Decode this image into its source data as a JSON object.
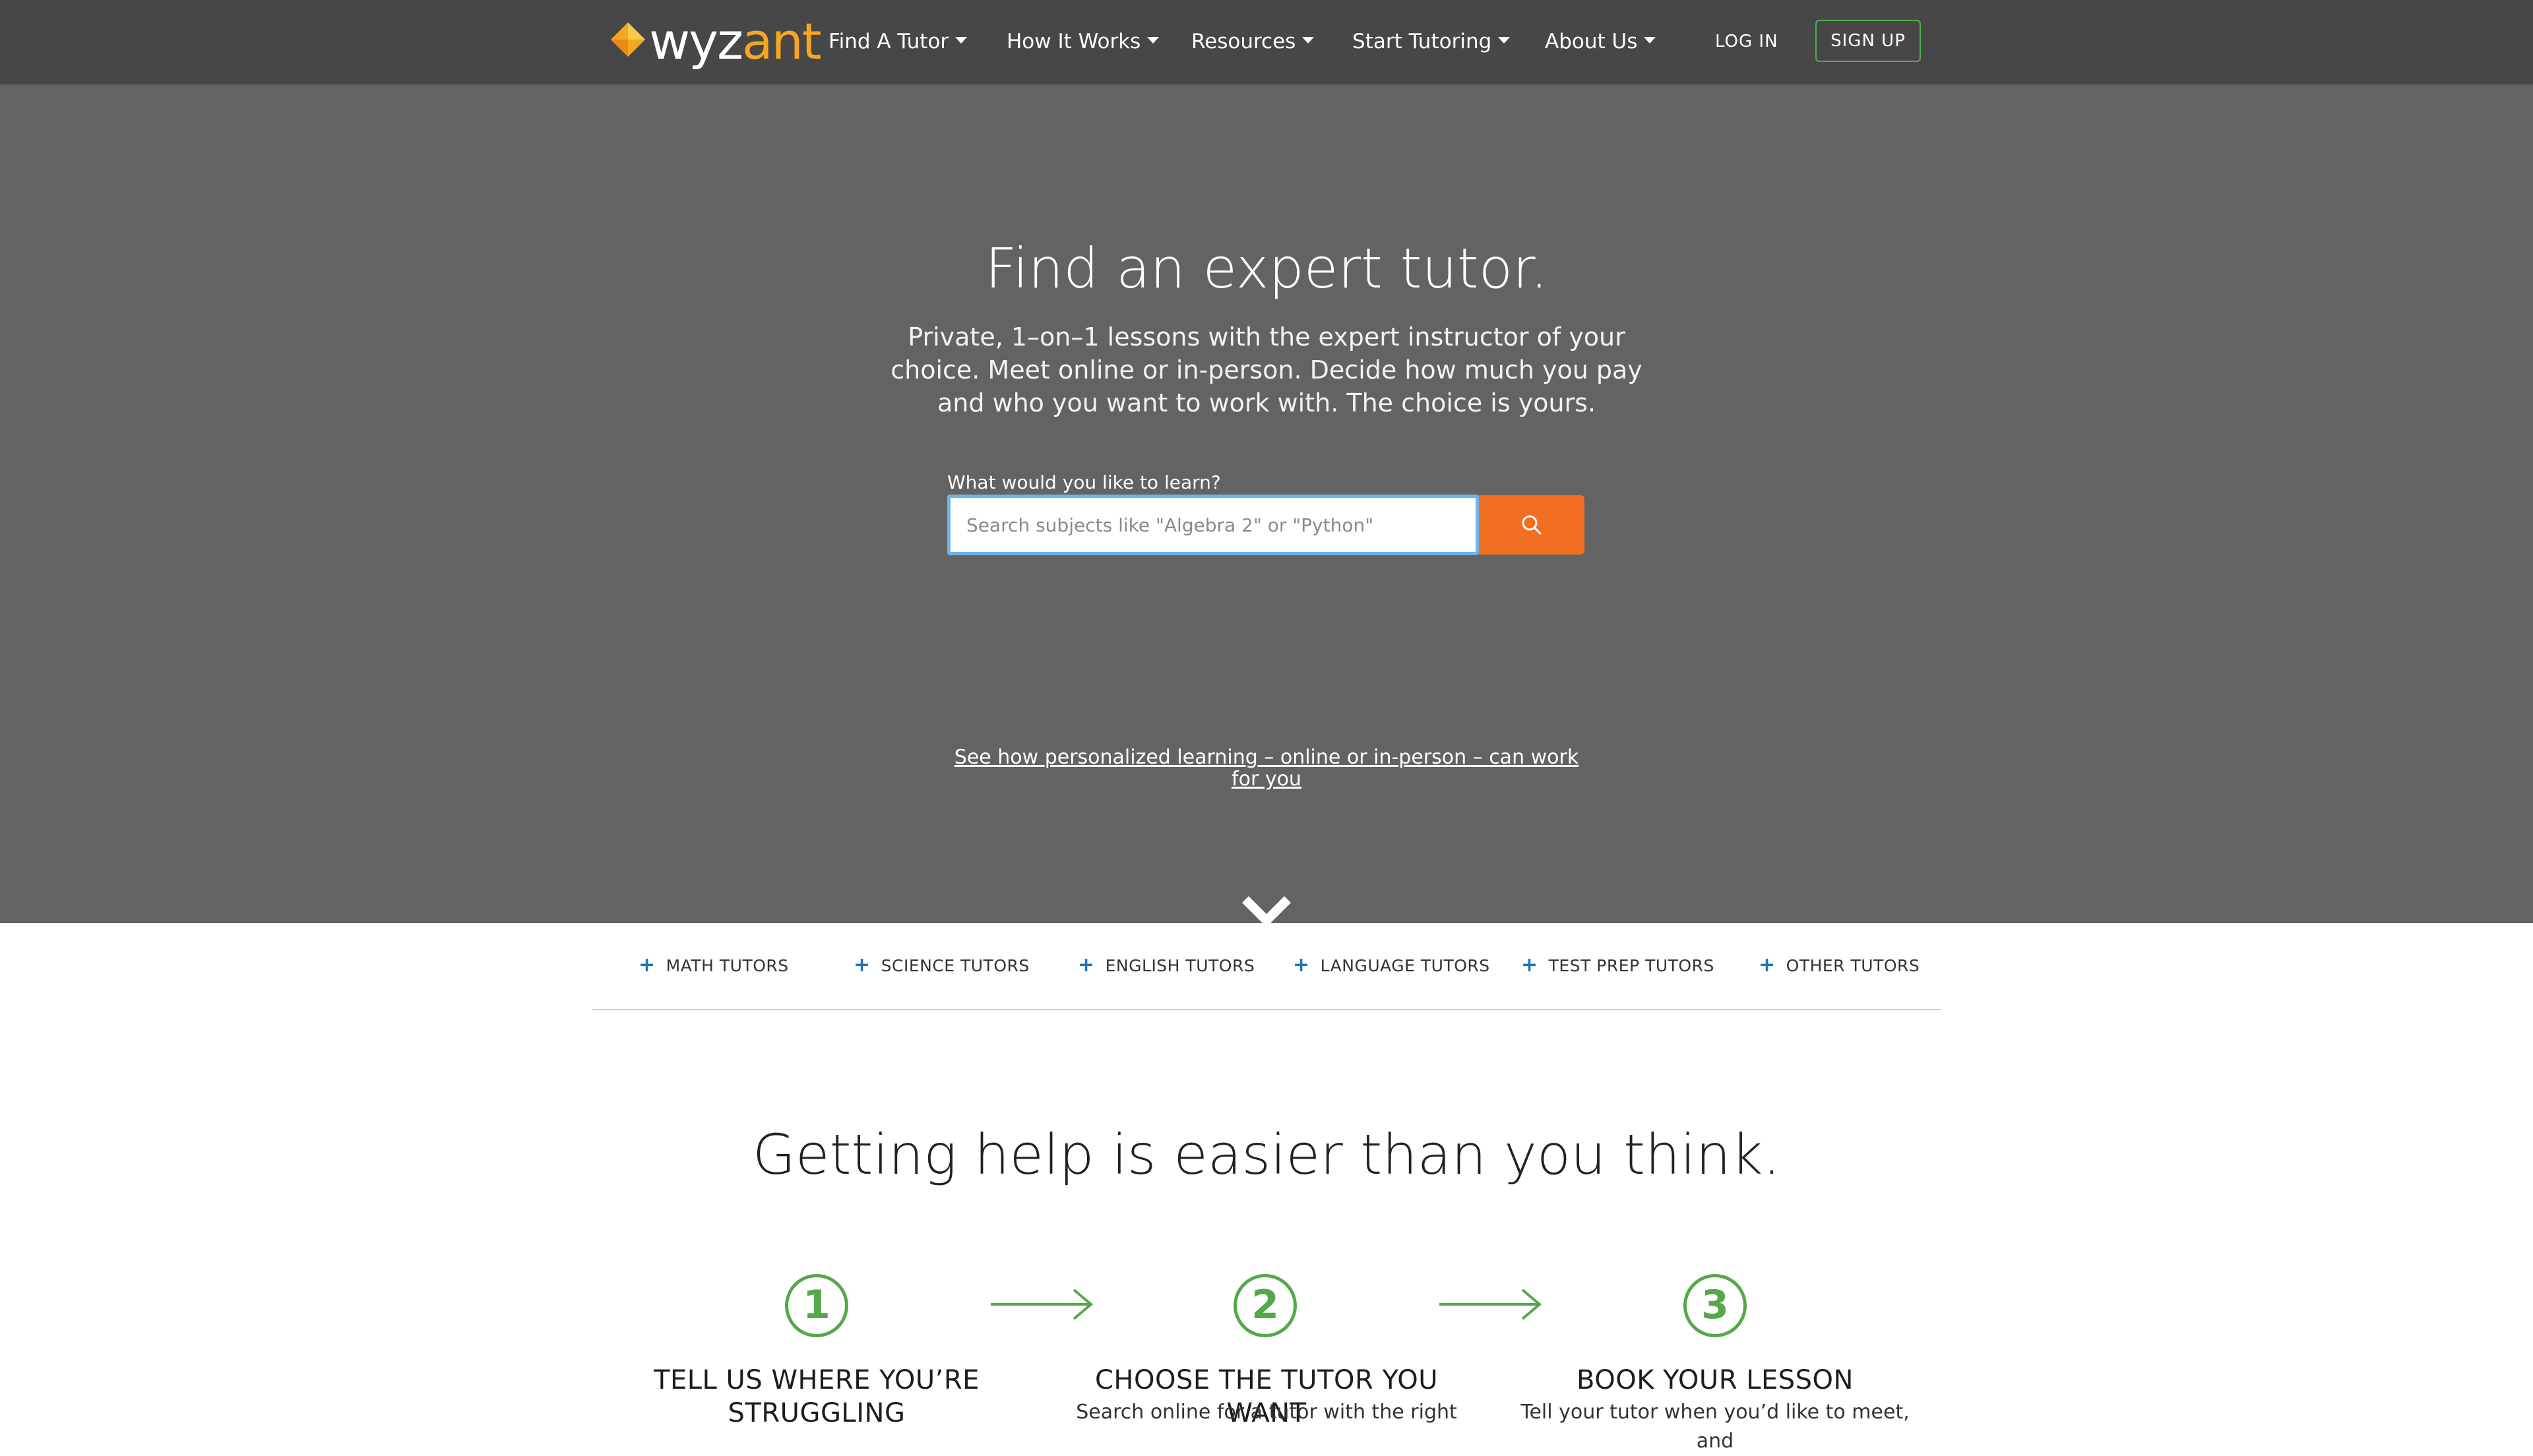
{
  "header": {
    "logo_text_main": "wyz",
    "logo_text_accent": "ant",
    "nav": [
      {
        "label": "Find A Tutor"
      },
      {
        "label": "How It Works"
      },
      {
        "label": "Resources"
      },
      {
        "label": "Start Tutoring"
      },
      {
        "label": "About Us"
      }
    ],
    "login_label": "LOG IN",
    "signup_label": "SIGN UP"
  },
  "hero": {
    "title": "Find an expert tutor.",
    "subtitle": "Private, 1–on–1 lessons with the expert instructor of your choice. Meet online or in-person. Decide how much you pay and who you want to work with. The choice is yours.",
    "search_label": "What would you like to learn?",
    "search_placeholder": "Search subjects like \"Algebra 2\" or \"Python\"",
    "search_value": "",
    "learn_link": "See how personalized learning – online or in-person – can work for you"
  },
  "categories": [
    {
      "label": "MATH TUTORS"
    },
    {
      "label": "SCIENCE TUTORS"
    },
    {
      "label": "ENGLISH TUTORS"
    },
    {
      "label": "LANGUAGE TUTORS"
    },
    {
      "label": "TEST PREP TUTORS"
    },
    {
      "label": "OTHER TUTORS"
    }
  ],
  "how": {
    "title": "Getting help is easier than you think.",
    "steps": [
      {
        "number": "1",
        "title": "TELL US WHERE YOU’RE STRUGGLING",
        "desc": ""
      },
      {
        "number": "2",
        "title": "CHOOSE THE TUTOR YOU WANT",
        "desc": "Search online for a tutor with the right"
      },
      {
        "number": "3",
        "title": "BOOK YOUR LESSON",
        "desc": "Tell your tutor when you’d like to meet, and"
      }
    ]
  },
  "colors": {
    "header_bg": "#474747",
    "hero_bg": "#636363",
    "accent_orange": "#f26f21",
    "accent_green": "#55a84a",
    "link_blue": "#1f74b8",
    "logo_yellow": "#f5a623"
  },
  "icons": {
    "logo": "wyzant-diamond-logo",
    "search": "search-icon",
    "scroll": "chevron-down-icon",
    "category": "plus-icon",
    "step_arrow": "arrow-right-icon",
    "nav_caret": "caret-down-icon"
  }
}
